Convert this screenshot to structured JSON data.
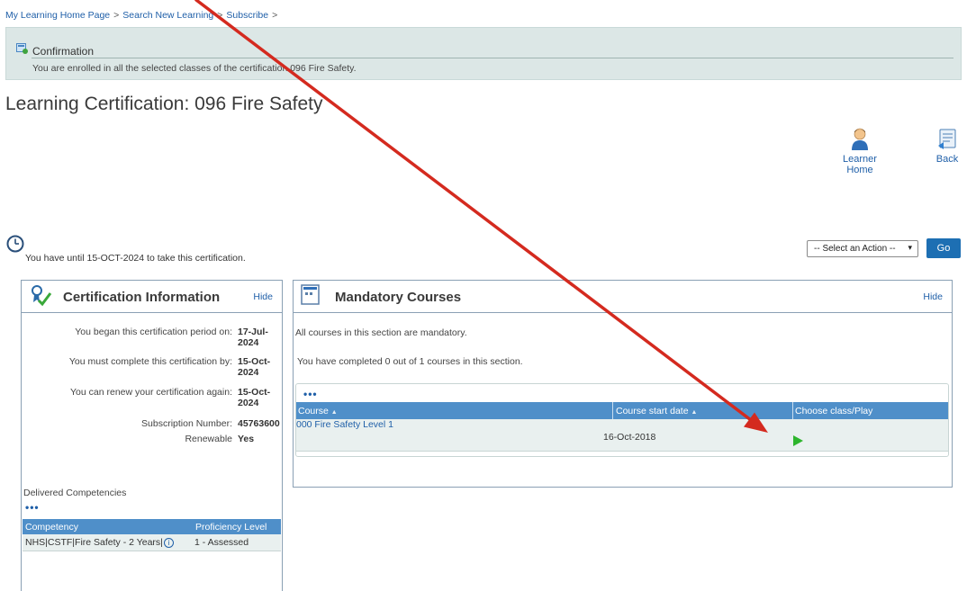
{
  "breadcrumb": {
    "items": [
      "My Learning Home Page",
      "Search New Learning",
      "Subscribe"
    ],
    "sep": ">"
  },
  "confirmation": {
    "title": "Confirmation",
    "message": "You are enrolled in all the selected classes of the certification 096 Fire Safety."
  },
  "page_title": "Learning Certification: 096 Fire Safety",
  "actions": {
    "learner_home": "Learner Home",
    "back": "Back"
  },
  "deadline_text": "You have until 15-OCT-2024 to take this certification.",
  "action_select": {
    "value": "-- Select an Action --",
    "chevron": "▾"
  },
  "go_label": "Go",
  "cert_info": {
    "title": "Certification Information",
    "hide": "Hide",
    "rows": [
      {
        "label": "You began this certification period on:",
        "value": "17-Jul-2024"
      },
      {
        "label": "You must complete this certification by:",
        "value": "15-Oct-2024"
      },
      {
        "label": "You can renew your certification again:",
        "value": "15-Oct-2024"
      },
      {
        "label": "Subscription Number:",
        "value": "45763600"
      },
      {
        "label": "Renewable",
        "value": "Yes"
      }
    ],
    "delivered_title": "Delivered Competencies",
    "dots": "•••",
    "columns": [
      "Competency",
      "Proficiency Level"
    ],
    "competencies": [
      {
        "name": "NHS|CSTF|Fire Safety - 2 Years|",
        "info": "i",
        "level": "1 - Assessed"
      }
    ]
  },
  "mandatory": {
    "title": "Mandatory Courses",
    "hide": "Hide",
    "note": "All courses in this section are mandatory.",
    "progress": "You have completed 0 out of 1 courses in this section.",
    "dots": "•••",
    "columns": [
      "Course",
      "Course start date",
      "Choose class/Play"
    ],
    "sort_glyph": "▲",
    "rows": [
      {
        "course": "000 Fire Safety Level 1",
        "start": "16-Oct-2018"
      }
    ]
  },
  "colors": {
    "accent": "#1d6fb3",
    "table_header": "#4f8fc9",
    "confirm_bg": "#dce7e6",
    "play": "#2db52d",
    "annotation_arrow": "#d42a1f"
  }
}
